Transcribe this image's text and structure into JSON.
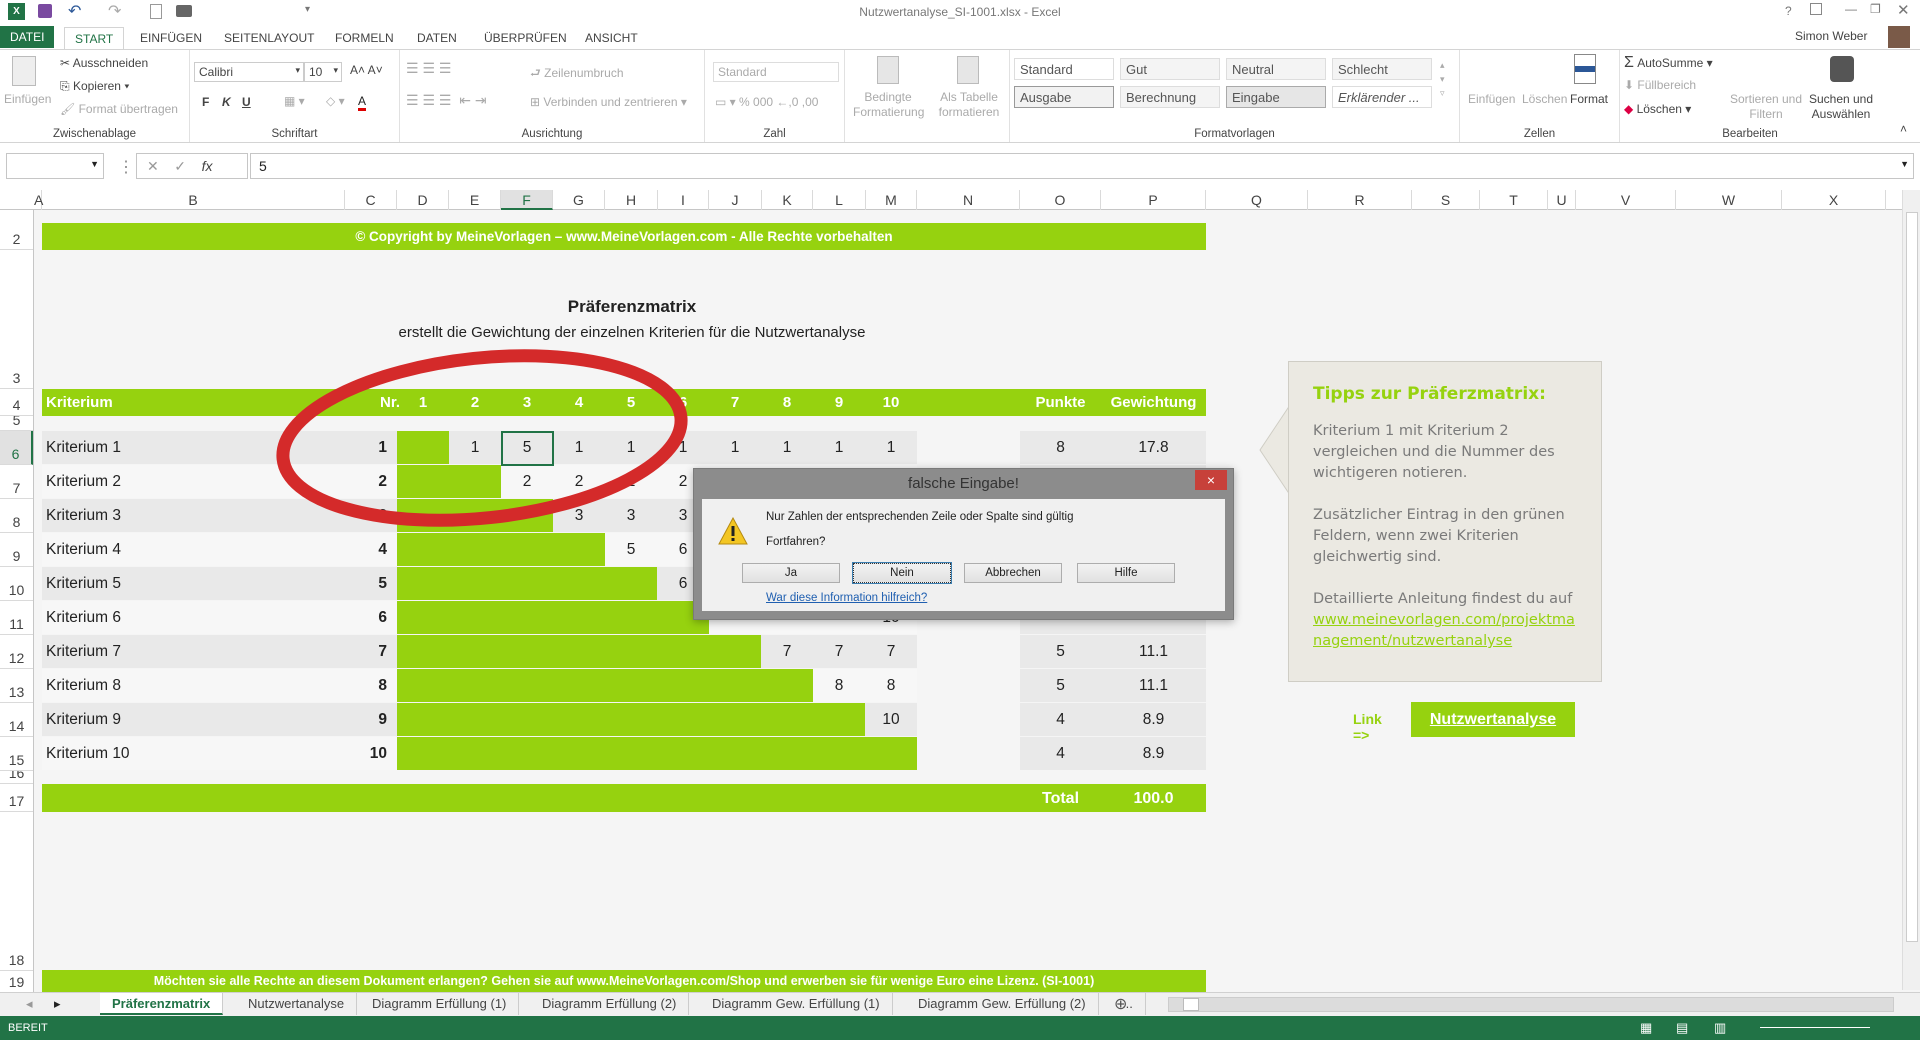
{
  "app": {
    "title": "Nutzwertanalyse_SI-1001.xlsx - Excel",
    "user": "Simon Weber",
    "help": "?"
  },
  "ribbon_tabs": [
    "DATEI",
    "START",
    "EINFÜGEN",
    "SEITENLAYOUT",
    "FORMELN",
    "DATEN",
    "ÜBERPRÜFEN",
    "ANSICHT"
  ],
  "ribbon": {
    "clipboard": {
      "label": "Zwischenablage",
      "paste": "Einfügen",
      "cut": "Ausschneiden",
      "copy": "Kopieren",
      "format_painter": "Format übertragen"
    },
    "font": {
      "label": "Schriftart",
      "font_name": "Calibri",
      "font_size": "10",
      "bold": "F",
      "italic": "K",
      "underline": "U"
    },
    "alignment": {
      "label": "Ausrichtung",
      "wrap": "Zeilenumbruch",
      "merge": "Verbinden und zentrieren"
    },
    "number": {
      "label": "Zahl",
      "format": "Standard",
      "percent": "%",
      "thousands": "000"
    },
    "cond_format": "Bedingte Formatierung",
    "as_table": "Als Tabelle formatieren",
    "styles": {
      "label": "Formatvorlagen",
      "items": [
        "Standard",
        "Gut",
        "Neutral",
        "Schlecht",
        "Ausgabe",
        "Berechnung",
        "Eingabe",
        "Erklärender ..."
      ]
    },
    "cells": {
      "label": "Zellen",
      "insert": "Einfügen",
      "delete": "Löschen",
      "format": "Format"
    },
    "editing": {
      "label": "Bearbeiten",
      "autosum": "AutoSumme",
      "fill": "Füllbereich",
      "clear": "Löschen",
      "sort": "Sortieren und Filtern",
      "find": "Suchen und Auswählen"
    }
  },
  "formula_bar": {
    "name_box": "",
    "fx": "fx",
    "value": "5"
  },
  "columns": [
    "A",
    "B",
    "C",
    "D",
    "E",
    "F",
    "G",
    "H",
    "I",
    "J",
    "K",
    "L",
    "M",
    "N",
    "O",
    "P",
    "Q",
    "R",
    "S",
    "T",
    "U",
    "V",
    "W",
    "X"
  ],
  "selected_column": "F",
  "rows": [
    "2",
    "3",
    "4",
    "5",
    "6",
    "7",
    "8",
    "9",
    "10",
    "11",
    "12",
    "13",
    "14",
    "15",
    "16",
    "17",
    "18",
    "19"
  ],
  "selected_row": "6",
  "sheet": {
    "copyright": "© Copyright by MeineVorlagen – www.MeineVorlagen.com - Alle Rechte vorbehalten",
    "title": "Präferenzmatrix",
    "subtitle": "erstellt die Gewichtung der einzelnen Kriterien für die Nutzwertanalyse",
    "header": {
      "criterion": "Kriterium",
      "nr": "Nr.",
      "cols": [
        "1",
        "2",
        "3",
        "4",
        "5",
        "6",
        "7",
        "8",
        "9",
        "10"
      ],
      "points": "Punkte",
      "weight": "Gewichtung"
    },
    "criteria": [
      {
        "name": "Kriterium 1",
        "nr": "1",
        "cells": [
          "",
          "1",
          "5",
          "1",
          "1",
          "1",
          "1",
          "1",
          "1",
          "1"
        ],
        "points": "8",
        "weight": "17.8"
      },
      {
        "name": "Kriterium 2",
        "nr": "2",
        "cells": [
          "",
          "",
          "2",
          "2",
          "2",
          "2",
          "",
          "",
          "",
          ""
        ],
        "points": "",
        "weight": ""
      },
      {
        "name": "Kriterium 3",
        "nr": "3",
        "cells": [
          "",
          "",
          "",
          "3",
          "3",
          "3",
          "",
          "",
          "",
          ""
        ],
        "points": "",
        "weight": ""
      },
      {
        "name": "Kriterium 4",
        "nr": "4",
        "cells": [
          "",
          "",
          "",
          "",
          "5",
          "6",
          "",
          "",
          "",
          ""
        ],
        "points": "",
        "weight": ""
      },
      {
        "name": "Kriterium 5",
        "nr": "5",
        "cells": [
          "",
          "",
          "",
          "",
          "",
          "6",
          "",
          "",
          "",
          ""
        ],
        "points": "",
        "weight": ""
      },
      {
        "name": "Kriterium 6",
        "nr": "6",
        "cells": [
          "",
          "",
          "",
          "",
          "",
          "",
          "",
          "",
          "",
          "10"
        ],
        "points": "",
        "weight": ""
      },
      {
        "name": "Kriterium 7",
        "nr": "7",
        "cells": [
          "",
          "",
          "",
          "",
          "",
          "",
          "",
          "7",
          "7",
          "7"
        ],
        "points": "5",
        "weight": "11.1"
      },
      {
        "name": "Kriterium 8",
        "nr": "8",
        "cells": [
          "",
          "",
          "",
          "",
          "",
          "",
          "",
          "",
          "8",
          "8"
        ],
        "points": "5",
        "weight": "11.1"
      },
      {
        "name": "Kriterium 9",
        "nr": "9",
        "cells": [
          "",
          "",
          "",
          "",
          "",
          "",
          "",
          "",
          "",
          "10"
        ],
        "points": "4",
        "weight": "8.9"
      },
      {
        "name": "Kriterium 10",
        "nr": "10",
        "cells": [
          "",
          "",
          "",
          "",
          "",
          "",
          "",
          "",
          "",
          ""
        ],
        "points": "4",
        "weight": "8.9"
      }
    ],
    "total_label": "Total",
    "total_value": "100.0",
    "footer": "Möchten sie alle Rechte an diesem Dokument erlangen? Gehen sie auf www.MeineVorlagen.com/Shop und erwerben sie für wenige Euro eine Lizenz. (SI-1001)",
    "selected_cell": {
      "row": "Kriterium 1",
      "col": "3",
      "value": "5"
    }
  },
  "tips": {
    "title": "Tipps zur Präferzmatrix:",
    "p1": "Kriterium 1 mit Kriterium 2 vergleichen und die Nummer des wichtigeren notieren.",
    "p2": "Zusätzlicher Eintrag in den grünen Feldern, wenn zwei Kriterien gleichwertig sind.",
    "p3": "Detaillierte Anleitung findest du auf",
    "link": "www.meinevorlagen.com/projektmanagement/nutzwertanalyse"
  },
  "link_label": "Link =>",
  "link_button": "Nutzwertanalyse",
  "dialog": {
    "title": "falsche Eingabe!",
    "message": "Nur Zahlen der entsprechenden Zeile oder Spalte sind gültig",
    "question": "Fortfahren?",
    "buttons": [
      "Ja",
      "Nein",
      "Abbrechen",
      "Hilfe"
    ],
    "help_link": "War diese Information hilfreich?",
    "close": "×"
  },
  "sheet_tabs": [
    "Präferenzmatrix",
    "Nutzwertanalyse",
    "Diagramm Erfüllung (1)",
    "Diagramm Erfüllung (2)",
    "Diagramm Gew. Erfüllung (1)",
    "Diagramm Gew. Erfüllung (2)",
    "..."
  ],
  "active_sheet": "Präferenzmatrix",
  "status": {
    "mode": "BEREIT"
  },
  "colors": {
    "accent": "#96d20f",
    "excel_green": "#217346",
    "ellipse": "#d42a2a"
  }
}
